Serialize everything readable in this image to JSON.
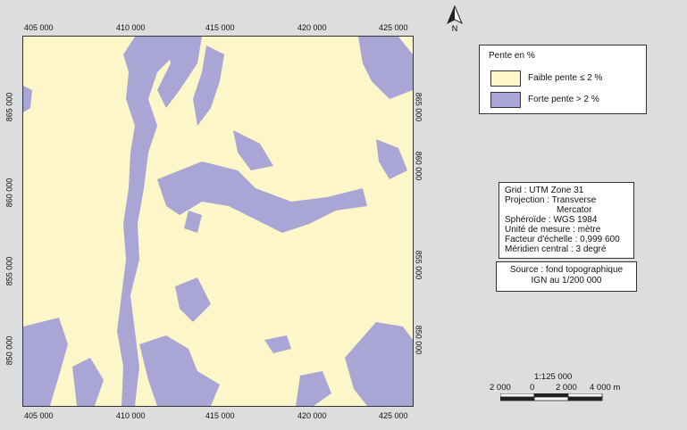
{
  "map": {
    "x_ticks": [
      "405 000",
      "410 000",
      "415 000",
      "420 000",
      "425 000"
    ],
    "y_ticks": [
      "865 000",
      "860 000",
      "855 000",
      "850 000"
    ],
    "north_label": "N"
  },
  "legend": {
    "title": "Pente en %",
    "items": [
      {
        "label": "Faible pente ≤ 2 %",
        "color": "#fdf6c8"
      },
      {
        "label": "Forte pente > 2 %",
        "color": "#a9a6d6"
      }
    ]
  },
  "info": {
    "grid": "Grid : UTM Zone 31",
    "projection": "Projection : Transverse",
    "projection2": "Mercator",
    "spheroid": "Sphéroïde : WGS 1984",
    "unit": "Unité de mesure : mètre",
    "scale_factor": "Facteur d'échelle : 0,999 600",
    "meridian": "Méridien central : 3 degré"
  },
  "source": {
    "line1": "Source : fond topographique",
    "line2": "IGN au 1/200 000"
  },
  "scalebar": {
    "ratio": "1:125 000",
    "labels": [
      "2 000",
      "0",
      "2 000",
      "4 000 m"
    ]
  },
  "colors": {
    "background": "#dcdddf",
    "low_slope": "#fdf6c8",
    "high_slope": "#a9a6d6"
  }
}
